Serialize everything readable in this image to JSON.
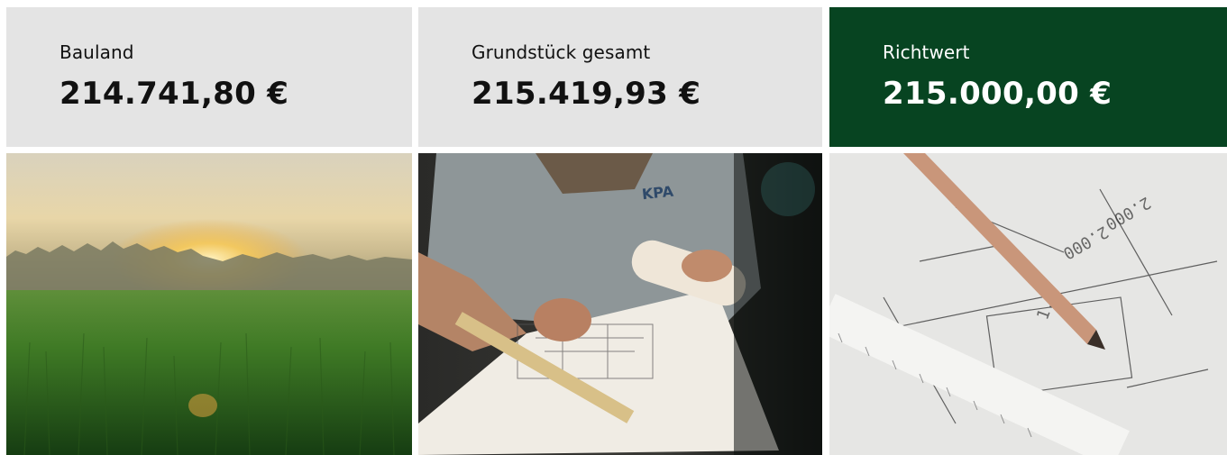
{
  "cards": [
    {
      "label": "Bauland",
      "value": "214.741,80 €"
    },
    {
      "label": "Grundstück gesamt",
      "value": "215.419,93 €"
    },
    {
      "label": "Richtwert",
      "value": "215.000,00 €"
    }
  ],
  "images": [
    {
      "icon": "grass-field-sunset-photo"
    },
    {
      "icon": "architect-drawing-plans-photo",
      "shirt_logo": "KPA"
    },
    {
      "icon": "blueprint-pencil-photo"
    }
  ],
  "colors": {
    "card_bg": "#e4e4e4",
    "accent_card_bg": "#074421",
    "text_dark": "#111111",
    "text_light": "#ffffff"
  }
}
